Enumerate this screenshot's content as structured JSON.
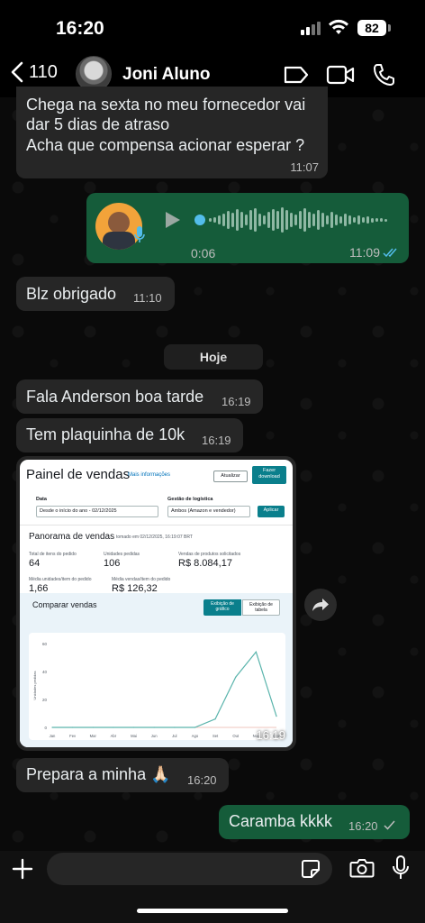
{
  "status_bar": {
    "time": "16:20",
    "battery": "82"
  },
  "header": {
    "back_count": "110",
    "contact_name": "Joni Aluno"
  },
  "messages": [
    {
      "id": "m1",
      "dir": "in",
      "lines": [
        "Chega na sexta no meu fornecedor vai",
        "dar 5 dias de atraso",
        "Acha que compensa acionar esperar ?"
      ],
      "time": "11:07"
    },
    {
      "id": "m2",
      "dir": "out",
      "type": "voice",
      "duration": "0:06",
      "time": "11:09",
      "status": "read"
    },
    {
      "id": "m3",
      "dir": "in",
      "text": "Blz obrigado",
      "time": "11:10"
    },
    {
      "id": "m4",
      "dir": "in",
      "text": "Fala Anderson boa tarde",
      "time": "16:19"
    },
    {
      "id": "m5",
      "dir": "in",
      "text": "Tem plaquinha de 10k",
      "time": "16:19"
    },
    {
      "id": "m6",
      "dir": "in",
      "type": "image",
      "time": "16:19"
    },
    {
      "id": "m7",
      "dir": "in",
      "text": "Prepara a minha 🙏🏻",
      "time": "16:20"
    },
    {
      "id": "m8",
      "dir": "out",
      "text": "Caramba kkkk",
      "time": "16:20",
      "status": "sent"
    }
  ],
  "day_divider": "Hoje",
  "screenshot": {
    "title": "Painel de vendas",
    "more_info": "Mais informações",
    "btn_update": "Atualizar",
    "btn_download": "Fazer download",
    "date_label": "Data",
    "date_value": "Desde o início do ano - 02/12/2025",
    "logistics_label": "Gestão de logística",
    "logistics_value": "Ambos (Amazon e vendedor)",
    "btn_apply": "Aplicar",
    "overview_title": "Panorama de vendas",
    "overview_time": "tomado em 02/12/2025, 16:19:07 BRT",
    "metrics": [
      {
        "label": "Total de itens do pedido",
        "value": "64"
      },
      {
        "label": "Unidades pedidas",
        "value": "106"
      },
      {
        "label": "Vendas de produtos solicitados",
        "value": "R$ 8.084,17"
      },
      {
        "label": "Média unidades/item do pedido",
        "value": "1,66"
      },
      {
        "label": "Média vendas/item do pedido",
        "value": "R$ 126,32"
      }
    ],
    "compare_title": "Comparar vendas",
    "toggle_chart": "Exibição de gráfico",
    "toggle_table": "Exibição de tabela",
    "chart_data": {
      "type": "line",
      "ylabel": "Unidades pedidas",
      "categories": [
        "Jan",
        "Fev",
        "Mar",
        "Abr",
        "Mai",
        "Jun",
        "Jul",
        "Ago",
        "Set",
        "Out",
        "Nov",
        "Dez"
      ],
      "values": [
        0,
        0,
        0,
        0,
        0,
        0,
        0,
        0,
        6,
        36,
        54,
        8
      ],
      "yticks": [
        "60",
        "40",
        "20",
        "0"
      ],
      "ylim": [
        0,
        60
      ],
      "color": "#5ab4ac"
    }
  },
  "colors": {
    "incoming": "#262626",
    "outgoing": "#155c3a",
    "read_check": "#53bdeb"
  }
}
